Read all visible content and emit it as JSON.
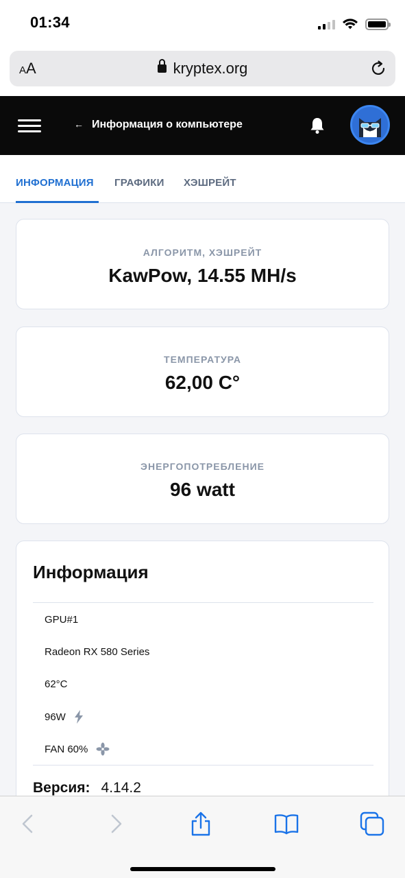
{
  "status_bar": {
    "time": "01:34"
  },
  "browser": {
    "text_size_label_small": "A",
    "text_size_label_large": "A",
    "url": "kryptex.org"
  },
  "header": {
    "back_arrow": "←",
    "title": "Информация о компьютере"
  },
  "tabs": [
    {
      "label": "ИНФОРМАЦИЯ",
      "active": true
    },
    {
      "label": "ГРАФИКИ",
      "active": false
    },
    {
      "label": "ХЭШРЕЙТ",
      "active": false
    }
  ],
  "stats": {
    "algorithm": {
      "label": "АЛГОРИТМ, ХЭШРЕЙТ",
      "value": "KawPow, 14.55 MH/s"
    },
    "temperature": {
      "label": "ТЕМПЕРАТУРА",
      "value": "62,00 C°"
    },
    "power": {
      "label": "ЭНЕРГОПОТРЕБЛЕНИЕ",
      "value": "96 watt"
    }
  },
  "info": {
    "title": "Информация",
    "gpu_id": "GPU#1",
    "gpu_name": "Radeon RX 580 Series",
    "gpu_temp": "62°C",
    "gpu_power": "96W",
    "gpu_fan": "FAN 60%",
    "version_label": "Версия:",
    "version_value": "4.14.2"
  },
  "colors": {
    "accent": "#1f6fd1",
    "header_bg": "#0a0a0a",
    "muted_label": "#8a96a8"
  },
  "icons": [
    "lock-icon",
    "reload-icon",
    "hamburger-icon",
    "bell-icon",
    "bolt-icon",
    "fan-icon",
    "back-icon",
    "forward-icon",
    "share-icon",
    "bookmarks-icon",
    "tabs-icon"
  ]
}
